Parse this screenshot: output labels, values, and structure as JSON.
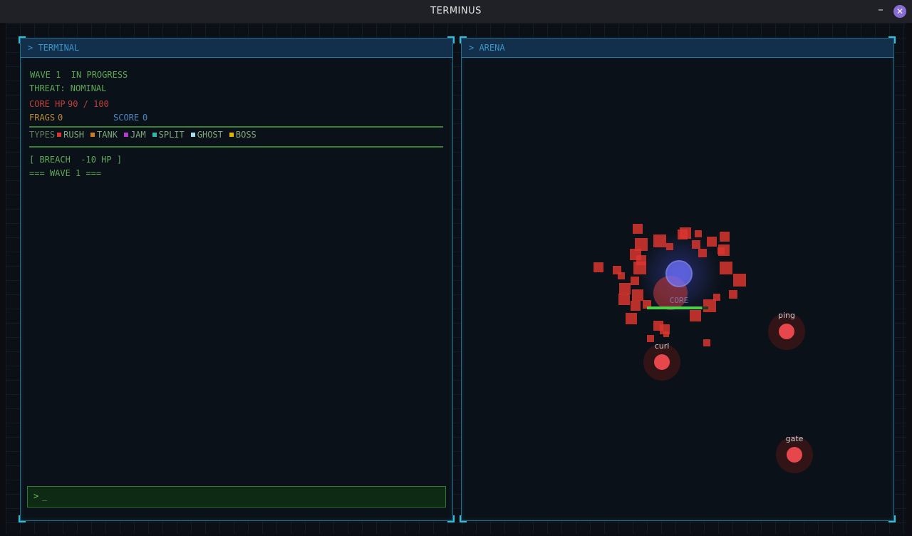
{
  "window": {
    "title": "TERMINUS",
    "minimize_label": "–",
    "close_label": "✕"
  },
  "terminal": {
    "header": "> TERMINAL",
    "wave_status": "WAVE 1  IN PROGRESS",
    "threat": "THREAT: NOMINAL",
    "core_hp_label": "CORE HP",
    "core_hp_value": "90 / 100",
    "frags_label": "FRAGS",
    "frags_value": "0",
    "score_label": "SCORE",
    "score_value": "0",
    "types_label": "TYPES",
    "types": [
      {
        "label": "RUSH",
        "color": "#d8352e"
      },
      {
        "label": "TANK",
        "color": "#d07a1e"
      },
      {
        "label": "JAM",
        "color": "#b23ad0"
      },
      {
        "label": "SPLIT",
        "color": "#2fb7a8"
      },
      {
        "label": "GHOST",
        "color": "#a8dcec"
      },
      {
        "label": "BOSS",
        "color": "#e0b400"
      }
    ],
    "log": [
      "[ BREACH  -10 HP ]",
      "=== WAVE 1 ==="
    ],
    "input": {
      "prompt": ">",
      "caret": "_"
    }
  },
  "arena": {
    "header": "> ARENA",
    "core_label": "CORE",
    "core_hp_fraction": 0.9,
    "nodes": [
      "ping",
      "curl",
      "gate"
    ]
  }
}
